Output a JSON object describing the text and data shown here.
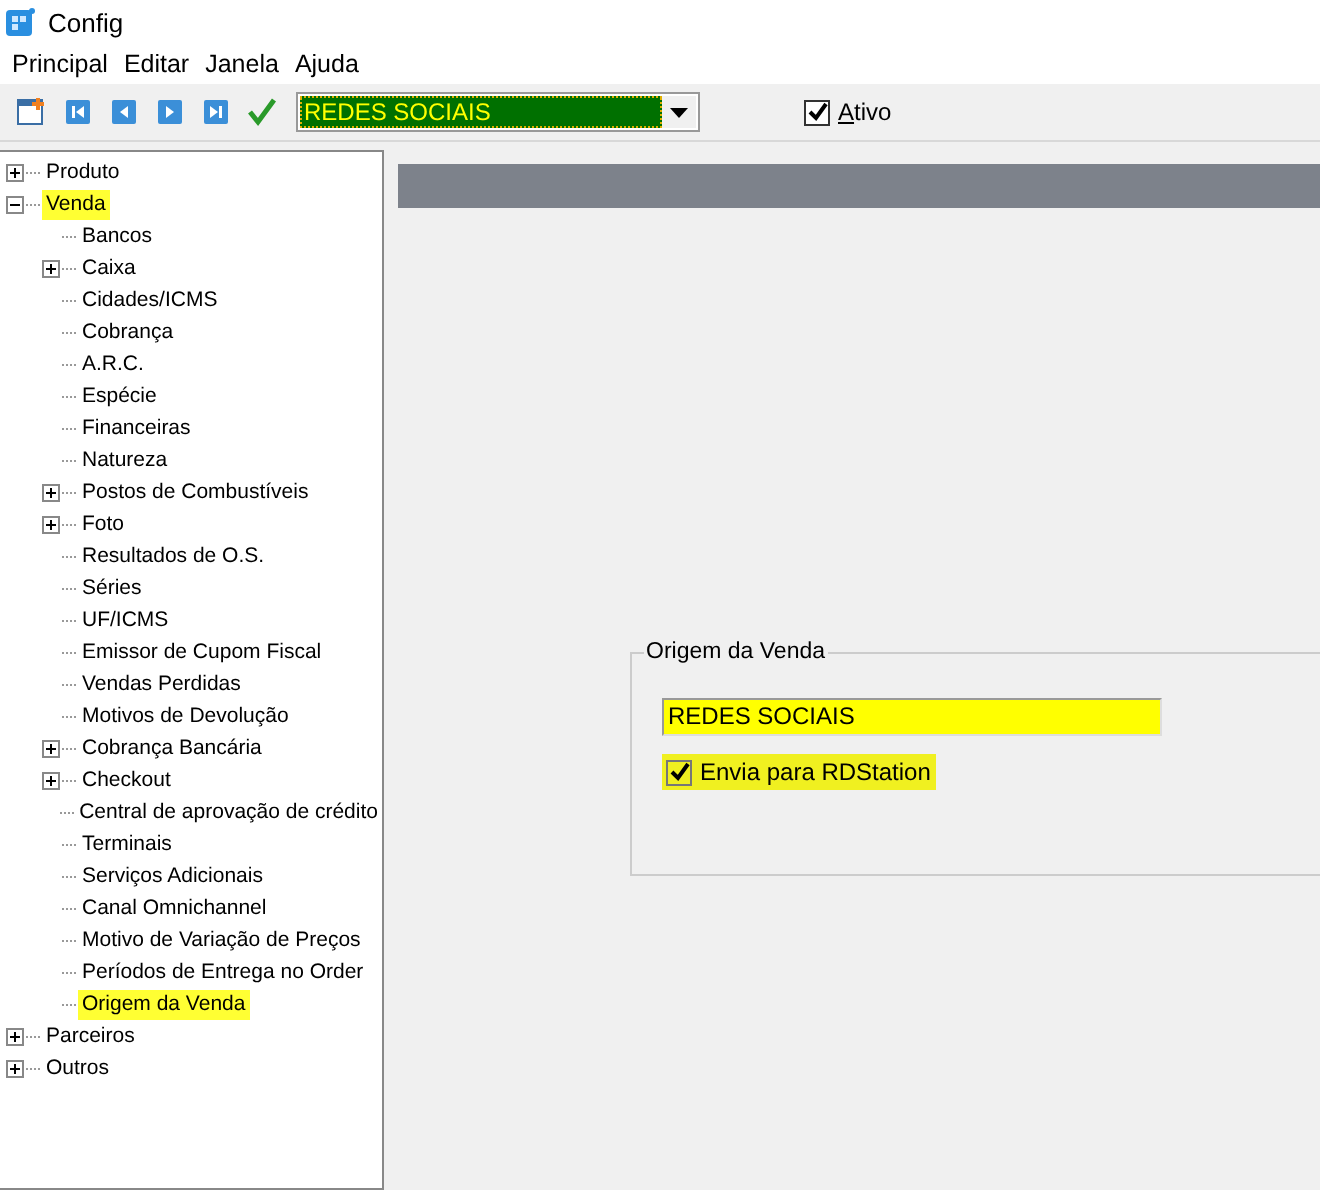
{
  "window": {
    "title": "Config"
  },
  "menu": [
    "Principal",
    "Editar",
    "Janela",
    "Ajuda"
  ],
  "toolbar": {
    "combo_value": "REDES SOCIAIS",
    "active": {
      "label": "Ativo",
      "checked": true
    }
  },
  "tree": [
    {
      "label": "Produto",
      "expandable": true,
      "expanded": false,
      "highlighted": false
    },
    {
      "label": "Venda",
      "expandable": true,
      "expanded": true,
      "highlighted": true,
      "children": [
        {
          "label": "Bancos",
          "expandable": false,
          "highlighted": false
        },
        {
          "label": "Caixa",
          "expandable": true,
          "expanded": false,
          "highlighted": false
        },
        {
          "label": "Cidades/ICMS",
          "expandable": false,
          "highlighted": false
        },
        {
          "label": "Cobrança",
          "expandable": false,
          "highlighted": false
        },
        {
          "label": "A.R.C.",
          "expandable": false,
          "highlighted": false
        },
        {
          "label": "Espécie",
          "expandable": false,
          "highlighted": false
        },
        {
          "label": "Financeiras",
          "expandable": false,
          "highlighted": false
        },
        {
          "label": "Natureza",
          "expandable": false,
          "highlighted": false
        },
        {
          "label": "Postos de Combustíveis",
          "expandable": true,
          "expanded": false,
          "highlighted": false
        },
        {
          "label": "Foto",
          "expandable": true,
          "expanded": false,
          "highlighted": false
        },
        {
          "label": "Resultados de O.S.",
          "expandable": false,
          "highlighted": false
        },
        {
          "label": "Séries",
          "expandable": false,
          "highlighted": false
        },
        {
          "label": "UF/ICMS",
          "expandable": false,
          "highlighted": false
        },
        {
          "label": "Emissor de Cupom Fiscal",
          "expandable": false,
          "highlighted": false
        },
        {
          "label": "Vendas Perdidas",
          "expandable": false,
          "highlighted": false
        },
        {
          "label": "Motivos de Devolução",
          "expandable": false,
          "highlighted": false
        },
        {
          "label": "Cobrança Bancária",
          "expandable": true,
          "expanded": false,
          "highlighted": false
        },
        {
          "label": "Checkout",
          "expandable": true,
          "expanded": false,
          "highlighted": false
        },
        {
          "label": "Central de aprovação de crédito",
          "expandable": false,
          "highlighted": false
        },
        {
          "label": "Terminais",
          "expandable": false,
          "highlighted": false
        },
        {
          "label": "Serviços Adicionais",
          "expandable": false,
          "highlighted": false
        },
        {
          "label": "Canal Omnichannel",
          "expandable": false,
          "highlighted": false
        },
        {
          "label": "Motivo de Variação de Preços",
          "expandable": false,
          "highlighted": false
        },
        {
          "label": "Períodos de Entrega no Order",
          "expandable": false,
          "highlighted": false
        },
        {
          "label": "Origem da Venda",
          "expandable": false,
          "highlighted": true
        }
      ]
    },
    {
      "label": "Parceiros",
      "expandable": true,
      "expanded": false,
      "highlighted": false
    },
    {
      "label": "Outros",
      "expandable": true,
      "expanded": false,
      "highlighted": false
    }
  ],
  "form": {
    "group_title": "Origem da Venda",
    "value": "REDES SOCIAIS",
    "send_rdstation": {
      "label": "Envia para RDStation",
      "checked": true
    }
  }
}
